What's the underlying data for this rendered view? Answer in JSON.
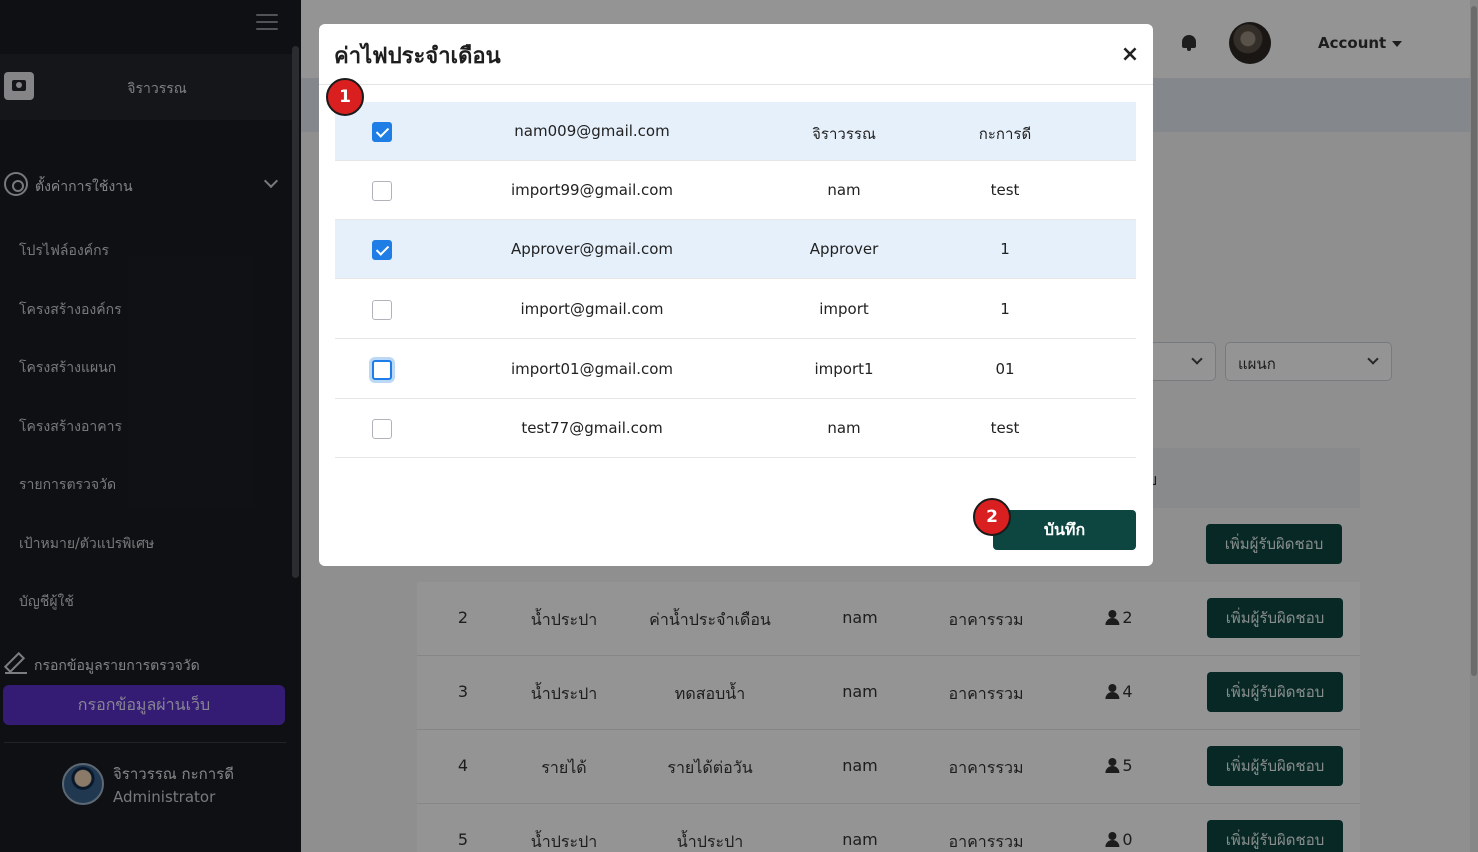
{
  "sidebar": {
    "org_name": "จิราวรรณ",
    "settings_label": "ตั้งค่าการใช้งาน",
    "nav_items": [
      {
        "label": "โปรไฟล์องค์กร"
      },
      {
        "label": "โครงสร้างองค์กร"
      },
      {
        "label": "โครงสร้างแผนก"
      },
      {
        "label": "โครงสร้างอาคาร"
      },
      {
        "label": "รายการตรวจวัด"
      },
      {
        "label": "เป้าหมาย/ตัวแปรพิเศษ"
      },
      {
        "label": "บัญชีผู้ใช้"
      }
    ],
    "form_label": "กรอกข้อมูลรายการตรวจวัด",
    "web_button": "กรอกข้อมูลผ่านเว็บ",
    "user_name": "จิราวรรณ กะการดี",
    "user_role": "Administrator"
  },
  "header": {
    "account_label": "Account"
  },
  "filters": {
    "department_placeholder": "แผนก"
  },
  "table": {
    "head_partial": "บ",
    "add_button_label": "เพิ่มผู้รับผิดชอบ",
    "rows": [
      {
        "no": "2",
        "category": "น้ำประปา",
        "name": "ค่าน้ำประจำเดือน",
        "user": "nam",
        "building": "อาคารรวม",
        "count": "2"
      },
      {
        "no": "3",
        "category": "น้ำประปา",
        "name": "ทดสอบน้ำ",
        "user": "nam",
        "building": "อาคารรวม",
        "count": "4"
      },
      {
        "no": "4",
        "category": "รายได้",
        "name": "รายได้ต่อวัน",
        "user": "nam",
        "building": "อาคารรวม",
        "count": "5"
      },
      {
        "no": "5",
        "category": "น้ำประปา",
        "name": "น้ำประปา",
        "user": "nam",
        "building": "อาคารรวม",
        "count": "0"
      }
    ]
  },
  "modal": {
    "title": "ค่าไฟประจำเดือน",
    "close_symbol": "×",
    "save_label": "บันทึก",
    "rows": [
      {
        "email": "nam009@gmail.com",
        "first_name": "จิราวรรณ",
        "last_name": "กะการดี",
        "checked": true
      },
      {
        "email": "import99@gmail.com",
        "first_name": "nam",
        "last_name": "test",
        "checked": false
      },
      {
        "email": "Approver@gmail.com",
        "first_name": "Approver",
        "last_name": "1",
        "checked": true
      },
      {
        "email": "import@gmail.com",
        "first_name": "import",
        "last_name": "1",
        "checked": false
      },
      {
        "email": "import01@gmail.com",
        "first_name": "import1",
        "last_name": "01",
        "checked": false
      },
      {
        "email": "test77@gmail.com",
        "first_name": "nam",
        "last_name": "test",
        "checked": false
      }
    ]
  },
  "markers": {
    "step1": "1",
    "step2": "2"
  },
  "colors": {
    "accent": "#0d4540",
    "checkbox_blue": "#1f7ee6",
    "marker_red": "#d91f1f",
    "sidebar_bg": "#1b1d22",
    "web_button": "#5b2fc6"
  }
}
